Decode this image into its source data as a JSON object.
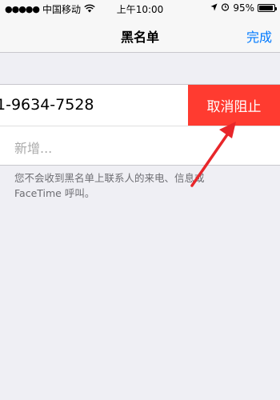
{
  "status_bar": {
    "signal_dots": "●●●●●",
    "carrier": "中国移动",
    "wifi_icon": "wifi-icon",
    "time": "上午10:00",
    "location_icon": "location-arrow-icon",
    "alarm_icon": "alarm-clock-icon",
    "battery_percent": "95%",
    "battery_level": 0.95
  },
  "nav": {
    "title": "黑名单",
    "done_label": "完成"
  },
  "blocked_list": {
    "entries": [
      {
        "phone": "1-9634-7528",
        "action_label": "取消阻止"
      }
    ],
    "add_label": "新增..."
  },
  "footnote": "您不会收到黑名单上联系人的来电、信息或 FaceTime 呼叫。",
  "colors": {
    "accent": "#007aff",
    "destructive": "#ff3b30",
    "annotation_arrow": "#e8262a"
  }
}
